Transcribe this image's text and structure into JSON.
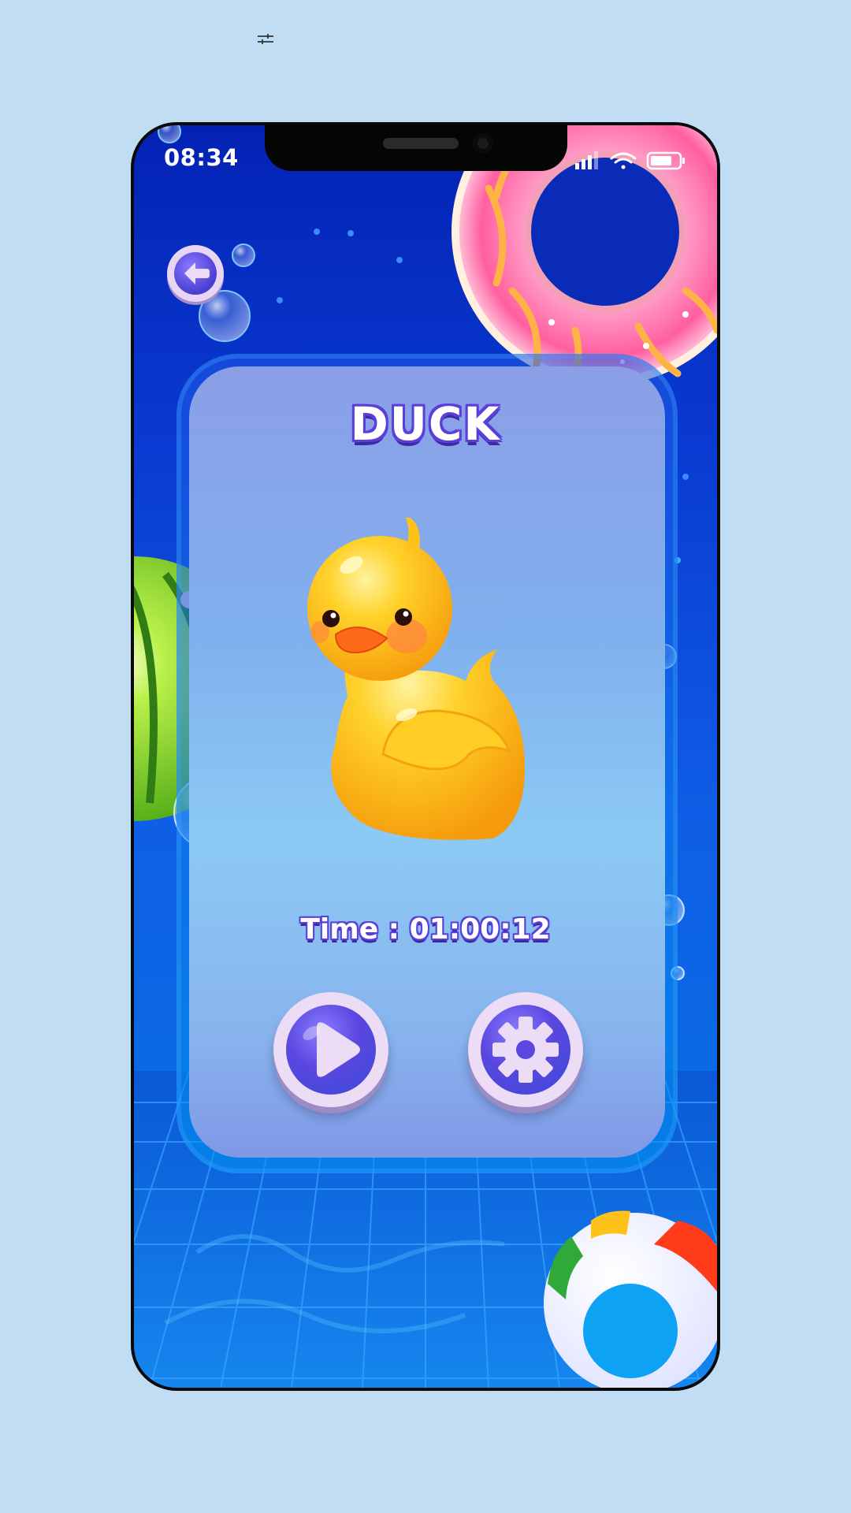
{
  "toolbar": {
    "icon": "sliders-icon"
  },
  "status_bar": {
    "time": "08:34",
    "icons": [
      "signal-icon",
      "wifi-icon",
      "battery-icon"
    ]
  },
  "header": {
    "back_icon": "arrow-left-icon"
  },
  "card": {
    "title": "DUCK",
    "character": "rubber-duck",
    "timer": "Time : 01:00:12"
  },
  "actions": {
    "play_icon": "play-icon",
    "settings_icon": "gear-icon"
  },
  "decorations": [
    "donut-float",
    "watermelon-ball",
    "beach-ball",
    "bubbles",
    "pool-tiles"
  ],
  "colors": {
    "background": "#c0ddf3",
    "title_outline": "#5a3fd8",
    "button_ring": "#ecdcf6",
    "duck": "#ffc21a"
  }
}
